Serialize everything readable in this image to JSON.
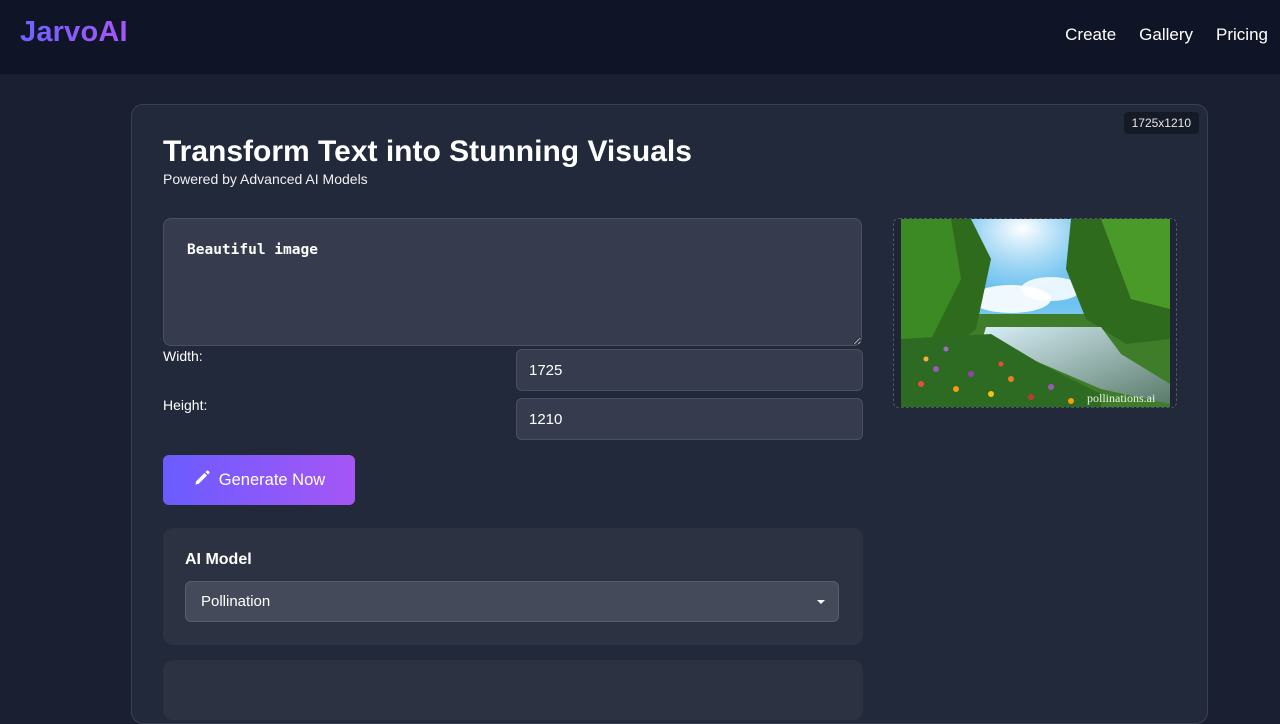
{
  "header": {
    "brand": "JarvoAI",
    "nav": [
      "Create",
      "Gallery",
      "Pricing"
    ]
  },
  "main": {
    "dimension_badge": "1725x1210",
    "title": "Transform Text into Stunning Visuals",
    "subtitle": "Powered by Advanced AI Models",
    "prompt_value": "Beautiful image",
    "width_label": "Width:",
    "width_value": "1725",
    "height_label": "Height:",
    "height_value": "1210",
    "generate_label": "Generate Now",
    "model_section": {
      "title": "AI Model",
      "selected": "Pollination"
    },
    "preview": {
      "watermark": "pollinations.ai"
    }
  },
  "colors": {
    "accent_start": "#6a5cff",
    "accent_end": "#a656f5",
    "background": "#1a2032",
    "card": "#22293b"
  },
  "icons": [
    "pencil-icon",
    "chevron-down-icon"
  ]
}
